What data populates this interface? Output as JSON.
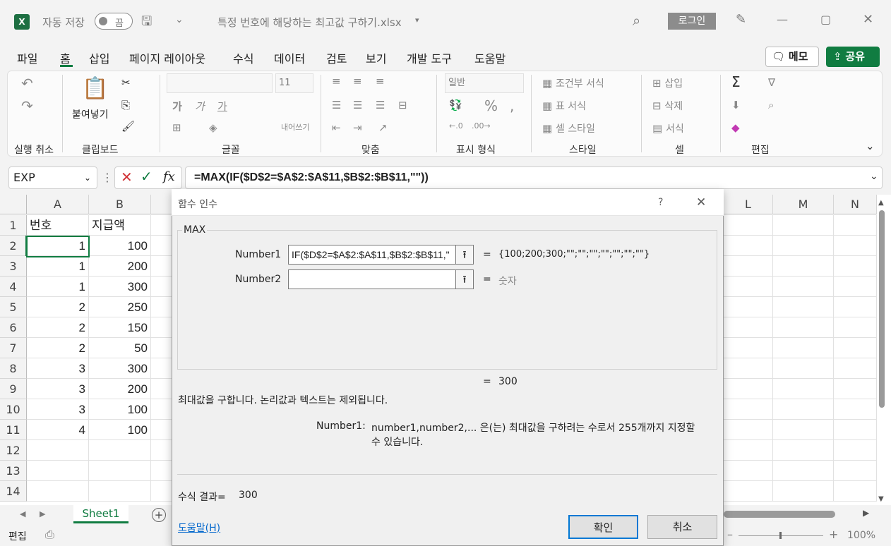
{
  "titlebar": {
    "autosave_label": "자동 저장",
    "autosave_state": "끔",
    "filename": "특정 번호에 해당하는 최고값 구하기.xlsx",
    "login_label": "로그인"
  },
  "menu": {
    "tabs": [
      "파일",
      "홈",
      "삽입",
      "페이지 레이아웃",
      "수식",
      "데이터",
      "검토",
      "보기",
      "개발 도구",
      "도움말"
    ],
    "memo_label": "메모",
    "share_label": "공유"
  },
  "ribbon": {
    "groups": [
      "실행 취소",
      "클립보드",
      "글꼴",
      "맞춤",
      "표시 형식",
      "스타일",
      "셀",
      "편집"
    ],
    "paste_label": "붙여넣기",
    "font_size": "11",
    "number_format": "일반",
    "wrap_label": "내어쓰기",
    "styles": [
      "조건부 서식",
      "표 서식",
      "셀 스타일"
    ],
    "cells": [
      "삽입",
      "삭제",
      "서식"
    ],
    "font_buttons": [
      "가",
      "가",
      "가"
    ],
    "pct": "%"
  },
  "formula_bar": {
    "name_box": "EXP",
    "fx": "fx",
    "formula": "=MAX(IF($D$2=$A$2:$A$11,$B$2:$B$11,\"\"))"
  },
  "sheet": {
    "columns": [
      "A",
      "B",
      "L",
      "M",
      "N"
    ],
    "rows": [
      {
        "n": "1",
        "a": "번호",
        "b": "지급액"
      },
      {
        "n": "2",
        "a": "1",
        "b": "100"
      },
      {
        "n": "3",
        "a": "1",
        "b": "200"
      },
      {
        "n": "4",
        "a": "1",
        "b": "300"
      },
      {
        "n": "5",
        "a": "2",
        "b": "250"
      },
      {
        "n": "6",
        "a": "2",
        "b": "150"
      },
      {
        "n": "7",
        "a": "2",
        "b": "50"
      },
      {
        "n": "8",
        "a": "3",
        "b": "300"
      },
      {
        "n": "9",
        "a": "3",
        "b": "200"
      },
      {
        "n": "10",
        "a": "3",
        "b": "100"
      },
      {
        "n": "11",
        "a": "4",
        "b": "100"
      },
      {
        "n": "12",
        "a": "",
        "b": ""
      },
      {
        "n": "13",
        "a": "",
        "b": ""
      },
      {
        "n": "14",
        "a": "",
        "b": ""
      }
    ],
    "tab_name": "Sheet1"
  },
  "dialog": {
    "title": "함수 인수",
    "help_q": "?",
    "function_name": "MAX",
    "arg1_label": "Number1",
    "arg1_value": "IF($D$2=$A$2:$A$11,$B$2:$B$11,\"",
    "arg1_result": "{100;200;300;\"\";\"\";\"\";\"\";\"\";\"\";\"\"}",
    "arg2_label": "Number2",
    "arg2_value": "",
    "arg2_result": "숫자",
    "eq": "=",
    "func_result": "300",
    "description": "최대값을 구합니다. 논리값과 텍스트는 제외됩니다.",
    "arg_help_label": "Number1:",
    "arg_help_text_1": "number1,number2,... 은(는) 최대값을 구하려는 수로서 255개까지 지정할",
    "arg_help_text_2": "수 있습니다.",
    "formula_result_label": "수식 결과=",
    "formula_result": "300",
    "help_link": "도움말(H)",
    "ok_label": "확인",
    "cancel_label": "취소"
  },
  "status": {
    "mode": "편집",
    "zoom": "100%"
  },
  "colors": {
    "accent": "#107c41",
    "excel": "#1d6f42",
    "error": "#d13438"
  }
}
